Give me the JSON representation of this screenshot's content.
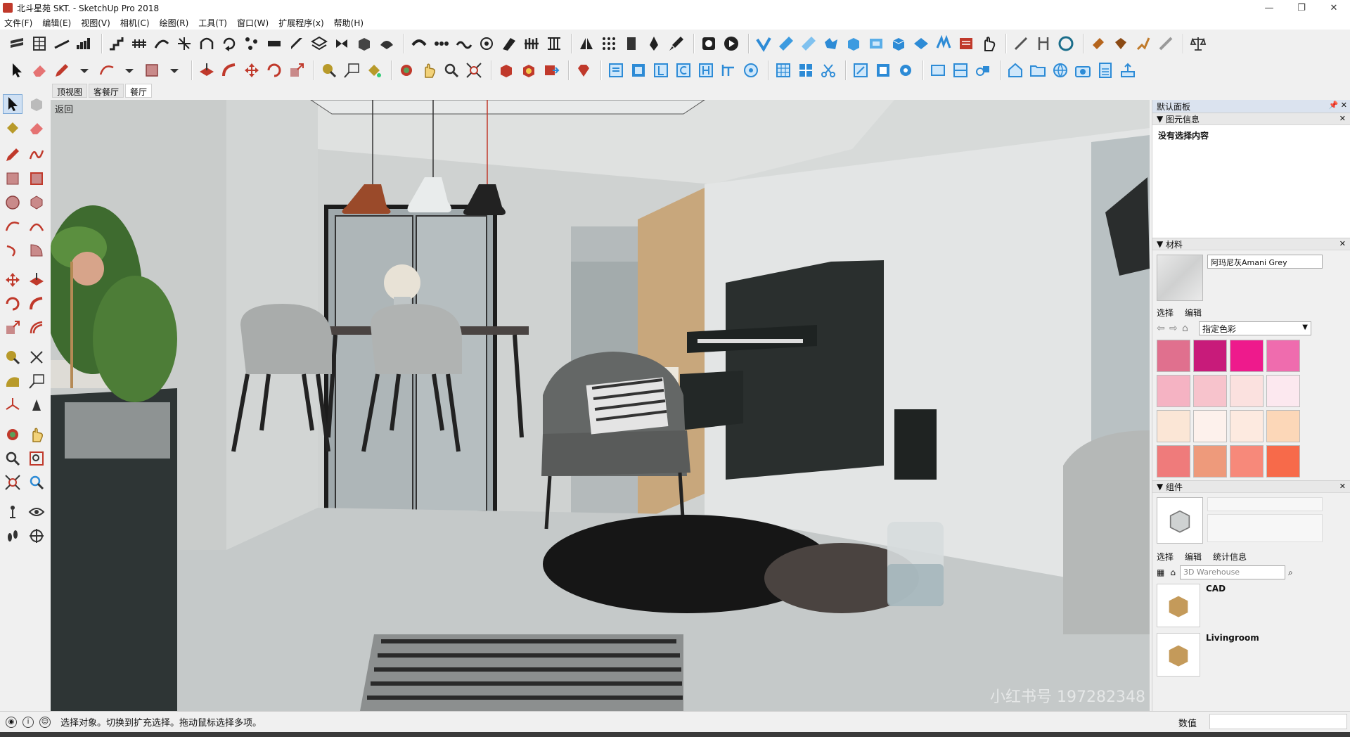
{
  "window": {
    "title": "北斗星苑  SKT. - SketchUp Pro 2018",
    "controls": [
      "—",
      "❐",
      "✕"
    ]
  },
  "menu": [
    "文件(F)",
    "编辑(E)",
    "视图(V)",
    "相机(C)",
    "绘图(R)",
    "工具(T)",
    "窗口(W)",
    "扩展程序(x)",
    "帮助(H)"
  ],
  "scenes": {
    "tabs": [
      "顶视图",
      "客餐厅",
      "餐厅"
    ],
    "active": "餐厅"
  },
  "viewport": {
    "back_label": "返回",
    "watermark": "小红书号 197282348"
  },
  "tray": {
    "title": "默认面板",
    "entity_info": {
      "header": "图元信息",
      "empty_text": "没有选择内容"
    },
    "materials": {
      "header": "材料",
      "current_name": "阿玛尼灰Amani Grey",
      "tab_select": "选择",
      "tab_edit": "编辑",
      "library": "指定色彩",
      "swatch_colors": [
        "#e0708e",
        "#c81b7a",
        "#ee1a8c",
        "#ef6cae",
        "#f5b3c3",
        "#f7c3cc",
        "#fbe1df",
        "#fce8ef",
        "#fbe6d6",
        "#fdf1ec",
        "#fdeae0",
        "#fcd7b8",
        "#ef7b7b",
        "#ee9a7b",
        "#f7897a",
        "#f76a4a"
      ]
    },
    "components": {
      "header": "组件",
      "tab_select": "选择",
      "tab_edit": "编辑",
      "tab_stats": "统计信息",
      "search_placeholder": "3D Warehouse",
      "items": [
        "CAD",
        "Livingroom"
      ]
    }
  },
  "status": {
    "message": "选择对象。切换到扩充选择。拖动鼠标选择多项。",
    "measurements_label": "数值"
  }
}
